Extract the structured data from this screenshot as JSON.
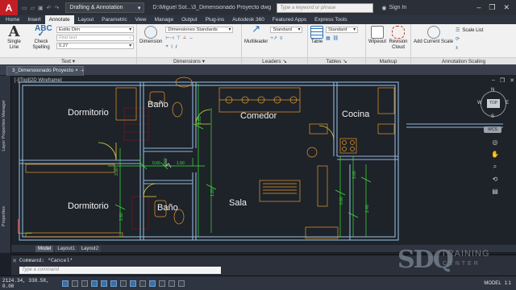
{
  "title_bar": {
    "workspace": "Drafting & Annotation",
    "document": "D:\\Miguel Sot...\\3_Dimensionado Proyecto",
    "document_ext": "dwg",
    "search_placeholder": "Type a keyword or phrase",
    "sign_in": "Sign In"
  },
  "ribbon_tabs": [
    "Home",
    "Insert",
    "Annotate",
    "Layout",
    "Parametric",
    "View",
    "Manage",
    "Output",
    "Plug-ins",
    "Autodesk 360",
    "Featured Apps",
    "Express Tools"
  ],
  "active_tab": "Annotate",
  "ribbon": {
    "text_panel": {
      "title": "Text",
      "single_line": "Single Line",
      "check_spelling": "Check Spelling",
      "style": "Estilo Dim",
      "find_placeholder": "Find text",
      "height": "0.27"
    },
    "dim_panel": {
      "title": "Dimensions",
      "dimension": "Dimension",
      "style": "Dimensiones Standards",
      "slash": "/"
    },
    "leaders_panel": {
      "title": "Leaders",
      "multileader": "Multileader",
      "style": "Standard"
    },
    "tables_panel": {
      "title": "Tables",
      "table": "Table",
      "style": "Standard"
    },
    "markup_panel": {
      "title": "Markup",
      "wipeout": "Wipeout",
      "revision_cloud": "Revision Cloud"
    },
    "scaling_panel": {
      "title": "Annotation Scaling",
      "add_scale": "Add Current Scale",
      "scale_list": "Scale List"
    }
  },
  "doc_tab": "3_Dimensionado Proyecto",
  "viewport_label": "[-][Top][2D Wireframe]",
  "viewcube": {
    "n": "N",
    "s": "S",
    "w": "W",
    "e": "E",
    "top": "TOP",
    "wcs": "WCS"
  },
  "side_palettes": [
    "Layer Properties Manager",
    "Properties"
  ],
  "rooms": [
    "Dormitorio",
    "Baño",
    "Comedor",
    "Cocina",
    "Dormitorio",
    "Baño",
    "Sala"
  ],
  "dims": [
    "3.50",
    "2.65",
    "1.20",
    "0.90",
    "3.00",
    "2.40",
    "0.60",
    "1.50",
    "2.80"
  ],
  "layout_tabs": [
    "Model",
    "Layout1",
    "Layout2"
  ],
  "active_layout": "Model",
  "command": {
    "history": "Command: *Cancel*",
    "placeholder": "Type a command"
  },
  "status": {
    "coords": "2124.34, 338.58, 0.00",
    "model": "MODEL",
    "scale": "1:1"
  },
  "watermark": {
    "logo": "SDQ",
    "line1": "TRAINING",
    "line2": "CENTER"
  },
  "colors": {
    "ribbon_bg": "#f1f1f1",
    "canvas_bg": "#1e2229",
    "walls": "#8fb7d9",
    "dims": "#3be43b",
    "furniture": "#e59a2a",
    "doors": "#d8d23c",
    "hatch": "#b02020"
  }
}
